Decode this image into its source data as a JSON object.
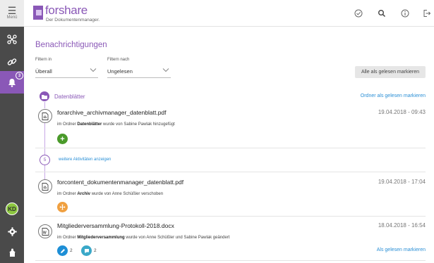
{
  "sidebar": {
    "menu_label": "Menü",
    "badge_count": "3",
    "avatar_initials": "KD"
  },
  "header": {
    "logo_name": "forshare",
    "logo_subtitle": "Der Dokumentenmanager."
  },
  "notifications": {
    "title": "Benachrichtigungen",
    "filter_in_label": "Filtern in",
    "filter_in_value": "Überall",
    "filter_by_label": "Filtern nach",
    "filter_by_value": "Ungelesen",
    "mark_all_button": "Alle als gelesen markieren",
    "folder": {
      "name": "Datenblätter",
      "mark_folder_link": "Ordner als gelesen markieren"
    },
    "items": [
      {
        "filename": "forarchive_archivmanager_datenblatt.pdf",
        "date": "19.04.2018 - 09:43",
        "desc_prefix": "im Ordner",
        "desc_folder": "Datenblätter",
        "desc_suffix": "wurde von Sabine Pawlak hinzugefügt"
      },
      {
        "filename": "forcontent_dokumentenmanager_datenblatt.pdf",
        "date": "19.04.2018 - 17:04",
        "desc_prefix": "im Ordner",
        "desc_folder": "Archiv",
        "desc_suffix": "wurde von Anne Schüßler verschoben"
      },
      {
        "filename": "Mitgliederversammlung-Protokoll-2018.docx",
        "date": "18.04.2018 - 16:54",
        "desc_prefix": "im Ordner",
        "desc_folder": "Mitgliederversammlung",
        "desc_suffix": "wurde von Anne Schüßler und Sabine Pawlak geändert",
        "edit_count": "2",
        "comment_count": "2",
        "mark_read_link": "Als gelesen markieren"
      }
    ],
    "more_count": "5",
    "more_link": "weitere Aktivitäten anzeigen"
  },
  "colors": {
    "accent": "#8a58b7",
    "link": "#2a8fd6",
    "add_green": "#4a9a2a",
    "move_orange": "#f0a040",
    "edit_blue": "#1e8fd6",
    "comment_teal": "#3aa8c8"
  }
}
